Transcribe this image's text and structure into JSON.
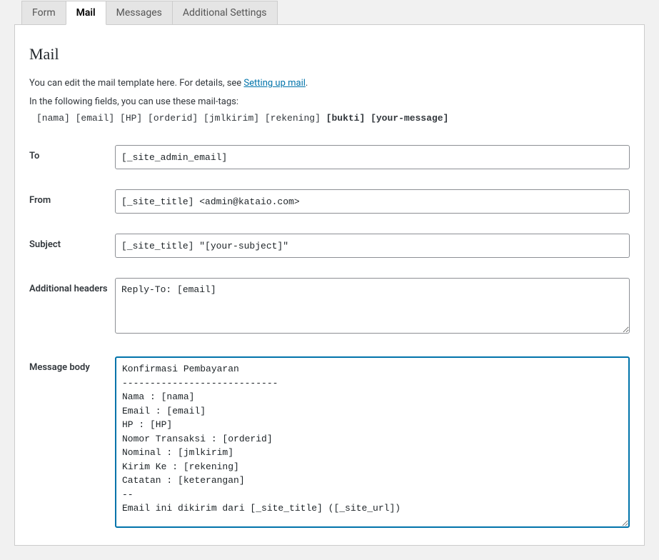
{
  "tabs": {
    "form": "Form",
    "mail": "Mail",
    "messages": "Messages",
    "additional_settings": "Additional Settings"
  },
  "section_title": "Mail",
  "desc": {
    "line1_prefix": "You can edit the mail template here. For details, see ",
    "line1_link": "Setting up mail",
    "line1_suffix": ".",
    "line2": "In the following fields, you can use these mail-tags:"
  },
  "mailtags": {
    "plain": "[nama] [email] [HP] [orderid] [jmlkirim] [rekening] ",
    "bold": "[bukti] [your-message]"
  },
  "fields": {
    "to": {
      "label": "To",
      "value": "[_site_admin_email]"
    },
    "from": {
      "label": "From",
      "value": "[_site_title] <admin@kataio.com>"
    },
    "subject": {
      "label": "Subject",
      "value": "[_site_title] \"[your-subject]\""
    },
    "additional_headers": {
      "label": "Additional headers",
      "value": "Reply-To: [email]"
    },
    "message_body": {
      "label": "Message body",
      "value": "Konfirmasi Pembayaran\n----------------------------\nNama : [nama]\nEmail : [email]\nHP : [HP]\nNomor Transaksi : [orderid]\nNominal : [jmlkirim]\nKirim Ke : [rekening]\nCatatan : [keterangan]\n--\nEmail ini dikirim dari [_site_title] ([_site_url])"
    }
  }
}
